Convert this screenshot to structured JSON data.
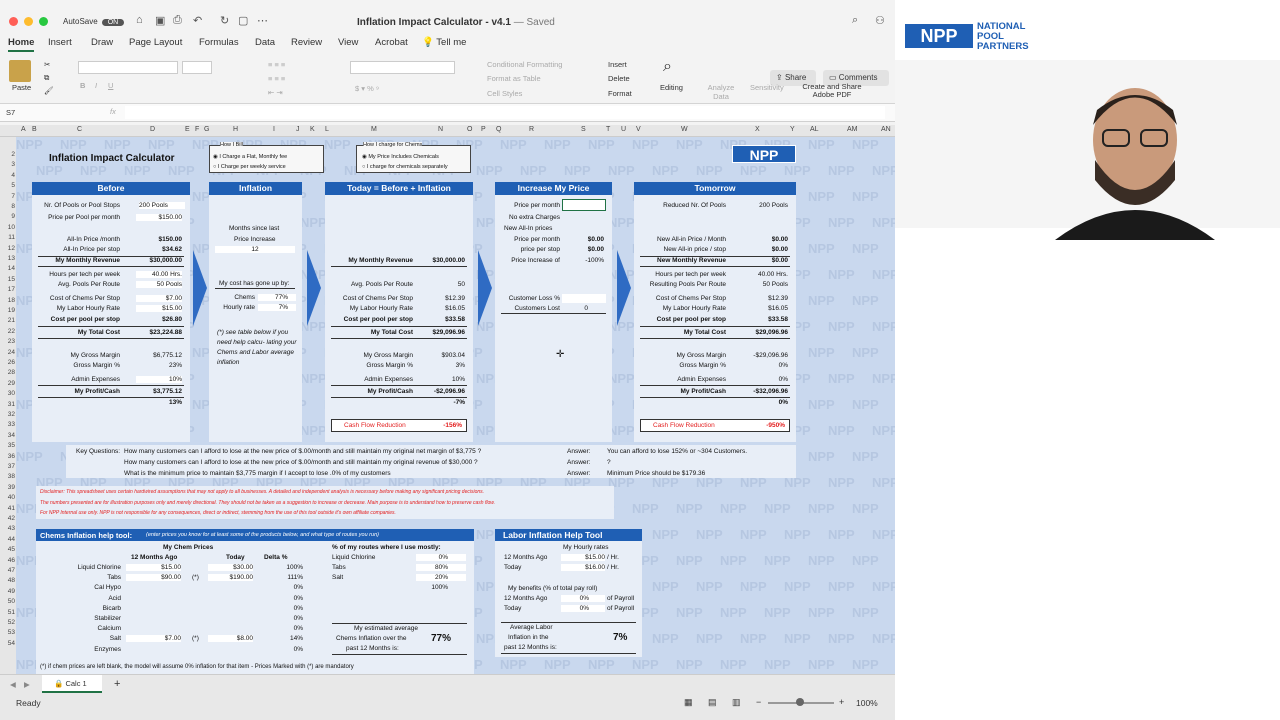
{
  "window": {
    "autosave": "AutoSave",
    "toggle": "ON",
    "title": "Inflation Impact Calculator - v4.1",
    "saved": "— Saved"
  },
  "tabs": [
    "Home",
    "Insert",
    "Draw",
    "Page Layout",
    "Formulas",
    "Data",
    "Review",
    "View",
    "Acrobat",
    "Tell me"
  ],
  "buttons": {
    "share": "Share",
    "comments": "Comments"
  },
  "ribbon": {
    "paste": "Paste",
    "cond": "Conditional Formatting",
    "fmt_table": "Format as Table",
    "cell_styles": "Cell Styles",
    "insert": "Insert",
    "delete": "Delete",
    "format": "Format",
    "editing": "Editing",
    "analyze": "Analyze Data",
    "sensitivity": "Sensitivity",
    "adobe": "Create and Share Adobe PDF"
  },
  "formula": {
    "cell": "S7",
    "fx": "fx"
  },
  "columns": [
    "A",
    "B",
    "C",
    "D",
    "E",
    "F",
    "G",
    "H",
    "I",
    "J",
    "K",
    "L",
    "M",
    "N",
    "O",
    "P",
    "Q",
    "R",
    "S",
    "T",
    "U",
    "V",
    "W",
    "X",
    "Y",
    "AL",
    "AM",
    "AN"
  ],
  "rows": [
    "2",
    "3",
    "4",
    "5",
    "7",
    "8",
    "9",
    "10",
    "11",
    "12",
    "13",
    "14",
    "15",
    "17",
    "18",
    "19",
    "21",
    "22",
    "23",
    "24",
    "26",
    "28",
    "29",
    "30",
    "31",
    "32",
    "33",
    "34",
    "35",
    "36",
    "37",
    "38",
    "39",
    "40",
    "41",
    "42",
    "43",
    "44",
    "45",
    "46",
    "47",
    "48",
    "49",
    "50",
    "51",
    "52",
    "53",
    "54"
  ],
  "sheet": {
    "title": "Inflation Impact Calculator",
    "bill": {
      "head": "How I Bill",
      "o1": "I Charge a Flat, Monthly fee",
      "o2": "I Charge per weekly service"
    },
    "chems": {
      "head": "How I charge for Chems",
      "o1": "My Price Includes Chemicals",
      "o2": "I charge for chemicals separately"
    },
    "before": {
      "head": "Before",
      "l1": "Nr. Of Pools or Pool Stops",
      "v1": "200 Pools",
      "l2": "Price per Pool per month",
      "v2": "$150.00",
      "l3": "All-In Price /month",
      "v3": "$150.00",
      "l4": "All-In Price per stop",
      "v4": "$34.62",
      "l5": "My Monthly Revenue",
      "v5": "$30,000.00",
      "l6": "Hours per tech per week",
      "v6": "40.00 Hrs.",
      "l7": "Avg. Pools Per Route",
      "v7": "50 Pools",
      "l8": "Cost of Chems Per Stop",
      "v8": "$7.00",
      "l9": "My Labor Hourly Rate",
      "v9": "$15.00",
      "l10": "Cost per pool per stop",
      "v10": "$26.80",
      "l11": "My Total Cost",
      "v11": "$23,224.88",
      "l12": "My Gross Margin",
      "v12": "$6,775.12",
      "l13": "Gross Margin %",
      "v13": "23%",
      "l14": "Admin Expenses",
      "v14": "10%",
      "l15": "My Profit/Cash",
      "v15": "$3,775.12",
      "v16": "13%"
    },
    "inflation": {
      "head": "Inflation",
      "l1": "Months since last",
      "l2": "Price Increase",
      "v2": "12",
      "l3": "My cost has gone up by:",
      "l4": "Chems",
      "v4": "77%",
      "l5": "Hourly rate",
      "v5": "7%",
      "note": "(*) see table below if you need help calcu- lating your Chems and Labor average inflation"
    },
    "today": {
      "head": "Today = Before + Inflation",
      "l5": "My Monthly Revenue",
      "v5": "$30,000.00",
      "l7": "Avg. Pools Per Route",
      "v7": "50",
      "l8": "Cost of Chems Per Stop",
      "v8": "$12.39",
      "l9": "My Labor Hourly Rate",
      "v9": "$16.05",
      "l10": "Cost per pool per stop",
      "v10": "$33.58",
      "l11": "My Total Cost",
      "v11": "$29,096.96",
      "l12": "My Gross Margin",
      "v12": "$903.04",
      "l13": "Gross Margin %",
      "v13": "3%",
      "l14": "Admin Expenses",
      "v14": "10%",
      "l15": "My Profit/Cash",
      "v15": "-$2,096.96",
      "v16": "-7%",
      "cf": "Cash Flow Reduction",
      "cfv": "-156%"
    },
    "increase": {
      "head": "Increase My Price",
      "l1": "Price per month",
      "l2": "No extra Charges",
      "l3": "New All-In prices",
      "l4": "Price per month",
      "v4": "$0.00",
      "l5": "price per stop",
      "v5": "$0.00",
      "l6": "Price Increase of",
      "v6": "-100%",
      "l7": "Customer Loss %",
      "l8": "Customers Lost",
      "v8": "0"
    },
    "tomorrow": {
      "head": "Tomorrow",
      "l1": "Reduced Nr. Of Pools",
      "v1": "200 Pools",
      "l3": "New All-in Price / Month",
      "v3": "$0.00",
      "l4": "New All-in price / stop",
      "v4": "$0.00",
      "l5": "New Monthly Revenue",
      "v5": "$0.00",
      "l6": "Hours per tech per week",
      "v6": "40.00 Hrs.",
      "l7": "Resulting Pools Per Route",
      "v7": "50 Pools",
      "l8": "Cost of Chems Per Stop",
      "v8": "$12.39",
      "l9": "My Labor Hourly Rate",
      "v9": "$16.05",
      "l10": "Cost per pool per stop",
      "v10": "$33.58",
      "l11": "My Total Cost",
      "v11": "$29,096.96",
      "l12": "My Gross Margin",
      "v12": "-$29,096.96",
      "l13": "Gross Margin %",
      "v13": "0%",
      "l14": "Admin Expenses",
      "v14": "0%",
      "l15": "My Profit/Cash",
      "v15": "-$32,096.96",
      "v16": "0%",
      "cf": "Cash Flow Reduction",
      "cfv": "-950%"
    },
    "questions": {
      "label": "Key Questions:",
      "q1": "How many customers can I afford to lose at the new price of $.00/month and still maintain my original net margin of $3,775 ?",
      "q2": "How many customers can I afford to lose at the new price of $.00/month and still maintain my original  revenue of $30,000 ?",
      "q3": "What is the minimum price to maintain $3,775 margin if I accept to lose .0% of my customers",
      "a": "Answer:",
      "a1": "You can afford to lose 152% or ~304 Customers.",
      "a2": "?",
      "a3": "Minimum Price should be $179.36"
    },
    "disclaimer": {
      "d1": "Disclaimer: This spreadsheet uses certain hardwired assumptions that may not apply to all businesses. A detailed and independent analysis is necessary before making any significant pricing decisions.",
      "d2": "The numbers  presented are for illustration purposes only and merely directional. They should not be taken as a suggestion to increase or decrease. Main purpose is to understand how to preserve cash flow.",
      "d3": "For NPP Internal use only. NPP is not responsible for any consequences, direct or indirect, stemming from the use of this tool outside it's own affiliate companies."
    },
    "chemtool": {
      "head": "Chems Inflation help tool:",
      "sub": "(enter prices you know for at least some of the products below, and what type of routes you run)",
      "mcp": "My Chem Prices",
      "c12": "12 Months Ago",
      "ctoday": "Today",
      "cdelta": "Delta %",
      "items": [
        {
          "n": "Liquid Chlorine",
          "a": "$15.00",
          "s": "",
          "t": "$30.00",
          "d": "100%"
        },
        {
          "n": "Tabs",
          "a": "$90.00",
          "s": "(*)",
          "t": "$190.00",
          "d": "111%"
        },
        {
          "n": "Cal Hypo",
          "a": "",
          "s": "",
          "t": "",
          "d": "0%"
        },
        {
          "n": "Acid",
          "a": "",
          "s": "",
          "t": "",
          "d": "0%"
        },
        {
          "n": "Bicarb",
          "a": "",
          "s": "",
          "t": "",
          "d": "0%"
        },
        {
          "n": "Stabilizer",
          "a": "",
          "s": "",
          "t": "",
          "d": "0%"
        },
        {
          "n": "Calcium",
          "a": "",
          "s": "",
          "t": "",
          "d": "0%"
        },
        {
          "n": "Salt",
          "a": "$7.00",
          "s": "(*)",
          "t": "$8.00",
          "d": "14%"
        },
        {
          "n": "Enzymes",
          "a": "",
          "s": "",
          "t": "",
          "d": "0%"
        }
      ],
      "routes": "% of my routes where I use mostly:",
      "r1": "Liquid Chlorine",
      "r1v": "0%",
      "r2": "Tabs",
      "r2v": "80%",
      "r3": "Salt",
      "r3v": "20%",
      "rtot": "100%",
      "est1": "My estimated average",
      "est2": "Chems Inflation over the",
      "est3": "past 12 Months is:",
      "estv": "77%",
      "foot": "(*) if chem prices are left blank, the model will assume 0% inflation for that item - Prices Marked with (*) are mandatory"
    },
    "labortool": {
      "head": "Labor Inflation Help Tool",
      "mhr": "My Hourly rates",
      "l1": "12 Months Ago",
      "v1": "$15.00",
      "u1": "/ Hr.",
      "l2": "Today",
      "v2": "$16.00",
      "u2": "/ Hr.",
      "ben": "My benefits (% of total pay roll)",
      "l3": "12 Months Ago",
      "v3": "0%",
      "u3": "of Payroll",
      "l4": "Today",
      "v4": "0%",
      "u4": "of Payroll",
      "avg1": "Average Labor",
      "avg2": "Inflation in the",
      "avg3": "past 12 Months is:",
      "avgv": "7%"
    },
    "logo": "NPP",
    "wm": "NPP"
  },
  "sheettab": "Calc 1",
  "status": {
    "ready": "Ready",
    "zoom": "100%"
  },
  "video": {
    "logo": "NPP",
    "brand1": "NATIONAL",
    "brand2": "POOL",
    "brand3": "PARTNERS"
  },
  "colors": {
    "accent": "#1f5fb4",
    "green": "#207245",
    "red": "#e32020"
  }
}
